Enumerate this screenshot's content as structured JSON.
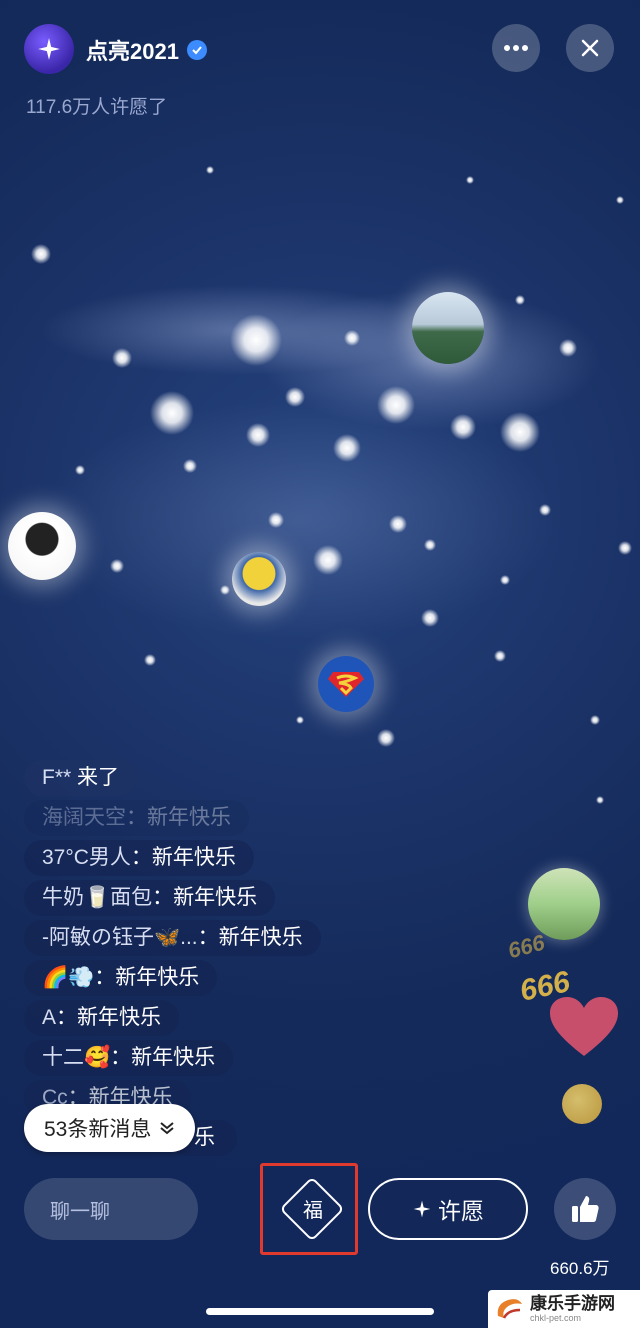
{
  "header": {
    "title": "点亮2021",
    "subtitle": "117.6万人许愿了"
  },
  "chat": {
    "messages": [
      {
        "user": "F**",
        "sep": " ",
        "text": "来了"
      },
      {
        "user": "海阔天空",
        "sep": "：",
        "text": "新年快乐"
      },
      {
        "user": "37°C男人",
        "sep": "：",
        "text": "新年快乐"
      },
      {
        "user": "牛奶🥛面包",
        "sep": "：",
        "text": "新年快乐"
      },
      {
        "user": "-阿敏の钰子🦋...",
        "sep": "：",
        "text": "新年快乐"
      },
      {
        "user": "🌈💨",
        "sep": "：",
        "text": "新年快乐"
      },
      {
        "user": "A",
        "sep": "：",
        "text": "新年快乐"
      },
      {
        "user": "十二🥰",
        "sep": "：",
        "text": "新年快乐"
      },
      {
        "user": "Cc",
        "sep": "：",
        "text": "新年快乐"
      },
      {
        "user": "",
        "sep": "",
        "text": "乐"
      }
    ],
    "new_messages": "53条新消息"
  },
  "bottom_bar": {
    "chat_placeholder": "聊一聊",
    "fu_label": "福",
    "wish_label": "许愿",
    "like_count": "660.6万"
  },
  "reactions": {
    "text_a": "666",
    "text_b": "666"
  },
  "watermark": {
    "title": "康乐手游网",
    "url": "chkl-pet.com"
  },
  "icons": [
    "sparkle-icon",
    "verified-icon",
    "more-icon",
    "close-icon",
    "chevron-down-icon",
    "thumbs-up-icon",
    "heart-icon",
    "emoji-icon"
  ],
  "colors": {
    "accent_red": "#e03a2f",
    "verified_blue": "#3c8cff",
    "background": "#1b3368"
  }
}
